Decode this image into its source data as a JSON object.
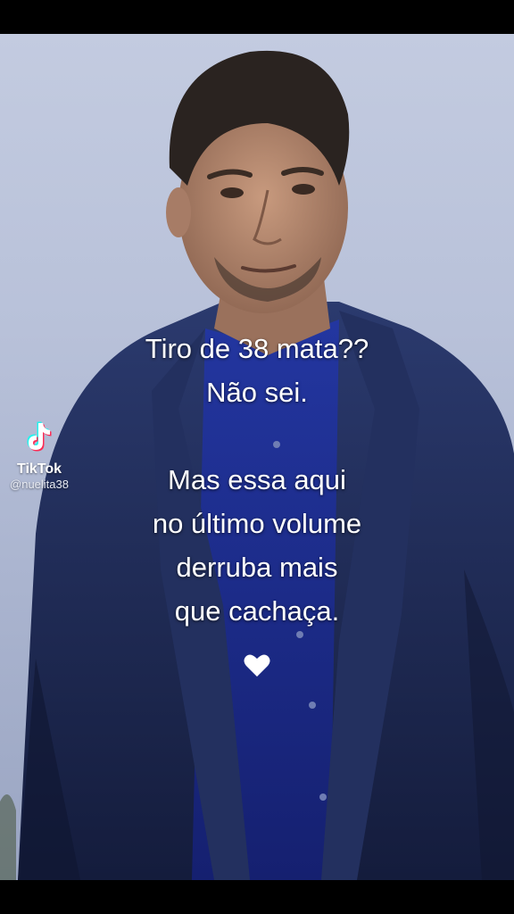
{
  "caption": {
    "line1": "Tiro de 38 mata??",
    "line2": "Não sei.",
    "line3": "Mas essa aqui",
    "line4": "no último volume",
    "line5": "derruba mais",
    "line6": "que cachaça."
  },
  "heart_icon": "white-heart-icon",
  "watermark": {
    "brand": "TikTok",
    "handle": "@nuelita38"
  },
  "colors": {
    "sky": "#b8c1d9",
    "jacket": "#1f2b55",
    "shirt": "#1b2a8a",
    "text": "#ffffff"
  }
}
